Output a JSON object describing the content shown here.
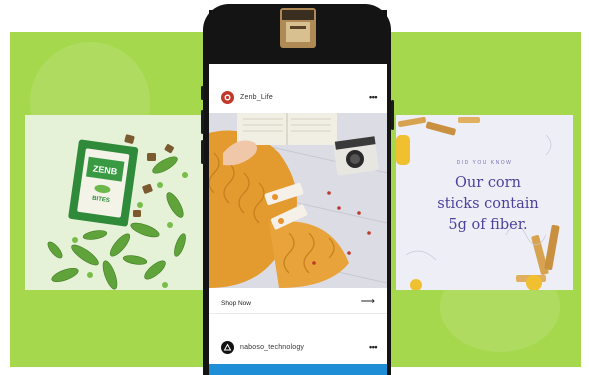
{
  "post1": {
    "username": "Zenb_Life",
    "more_icon": "•••"
  },
  "shop": {
    "label": "Shop Now",
    "arrow": "⟶"
  },
  "post2": {
    "username": "naboso_technology",
    "more_icon": "•••"
  },
  "fiber_ad": {
    "eyebrow": "DID YOU KNOW",
    "headline_1": "Our corn",
    "headline_2": "sticks contain",
    "headline_3": "5g of fiber."
  },
  "product": {
    "brand": "ZENB",
    "label": "BITES"
  },
  "colors": {
    "background": "#a6d84e",
    "headline": "#4e3f9a",
    "phone": "#141414",
    "blue_bar": "#1e8fd6"
  }
}
